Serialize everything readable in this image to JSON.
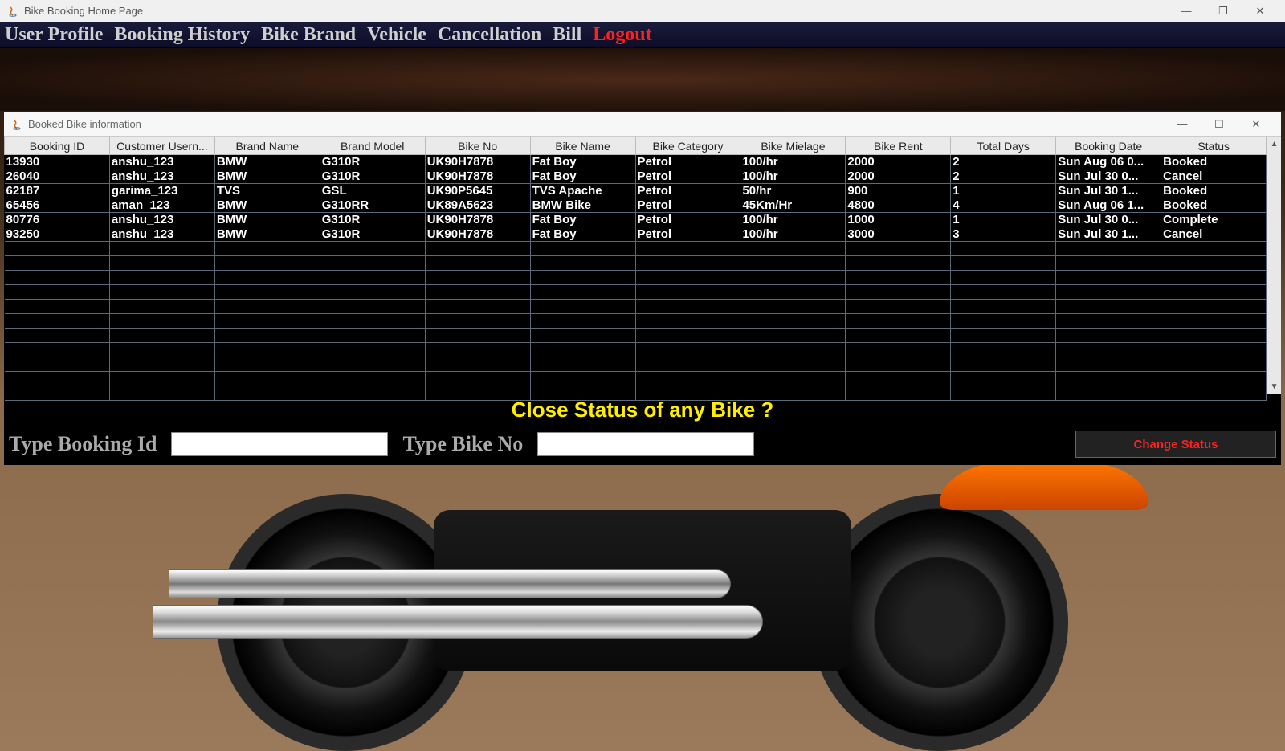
{
  "outerWindow": {
    "title": "Bike Booking Home Page",
    "controls": {
      "minimize": "—",
      "maximize": "❐",
      "close": "✕"
    }
  },
  "menu": {
    "items": [
      {
        "key": "user-profile",
        "label": "User Profile"
      },
      {
        "key": "booking-history",
        "label": "Booking History"
      },
      {
        "key": "bike-brand",
        "label": "Bike Brand"
      },
      {
        "key": "vehicle",
        "label": "Vehicle"
      },
      {
        "key": "cancellation",
        "label": "Cancellation"
      },
      {
        "key": "bill",
        "label": "Bill"
      },
      {
        "key": "logout",
        "label": "Logout",
        "accent": true
      }
    ]
  },
  "innerWindow": {
    "title": "Booked Bike information",
    "controls": {
      "minimize": "—",
      "maximize": "☐",
      "close": "✕"
    }
  },
  "table": {
    "columns": [
      "Booking ID",
      "Customer Usern...",
      "Brand Name",
      "Brand Model",
      "Bike No",
      "Bike Name",
      "Bike Category",
      "Bike Mielage",
      "Bike Rent",
      "Total Days",
      "Booking Date",
      "Status"
    ],
    "rows": [
      [
        "13930",
        "anshu_123",
        "BMW",
        "G310R",
        "UK90H7878",
        "Fat Boy",
        "Petrol",
        "100/hr",
        "2000",
        "2",
        "Sun Aug 06 0...",
        "Booked"
      ],
      [
        "26040",
        "anshu_123",
        "BMW",
        "G310R",
        "UK90H7878",
        "Fat Boy",
        "Petrol",
        "100/hr",
        "2000",
        "2",
        "Sun Jul 30 0...",
        "Cancel"
      ],
      [
        "62187",
        "garima_123",
        "TVS",
        "GSL",
        "UK90P5645",
        "TVS Apache",
        "Petrol",
        "50/hr",
        "900",
        "1",
        "Sun Jul 30 1...",
        "Booked"
      ],
      [
        "65456",
        "aman_123",
        "BMW",
        "G310RR",
        "UK89A5623",
        "BMW Bike",
        "Petrol",
        "45Km/Hr",
        "4800",
        "4",
        "Sun Aug 06 1...",
        "Booked"
      ],
      [
        "80776",
        "anshu_123",
        "BMW",
        "G310R",
        "UK90H7878",
        "Fat Boy",
        "Petrol",
        "100/hr",
        "1000",
        "1",
        "Sun Jul 30 0...",
        "Complete"
      ],
      [
        "93250",
        "anshu_123",
        "BMW",
        "G310R",
        "UK90H7878",
        "Fat Boy",
        "Petrol",
        "100/hr",
        "3000",
        "3",
        "Sun Jul 30 1...",
        "Cancel"
      ]
    ],
    "emptyRows": 11
  },
  "prompt": {
    "heading": "Close Status of any Bike ?",
    "bookingIdLabel": "Type Booking Id",
    "bikeNoLabel": "Type Bike No",
    "bookingIdValue": "",
    "bikeNoValue": "",
    "changeButton": "Change Status"
  },
  "scrollbar": {
    "up": "▲",
    "down": "▼"
  }
}
